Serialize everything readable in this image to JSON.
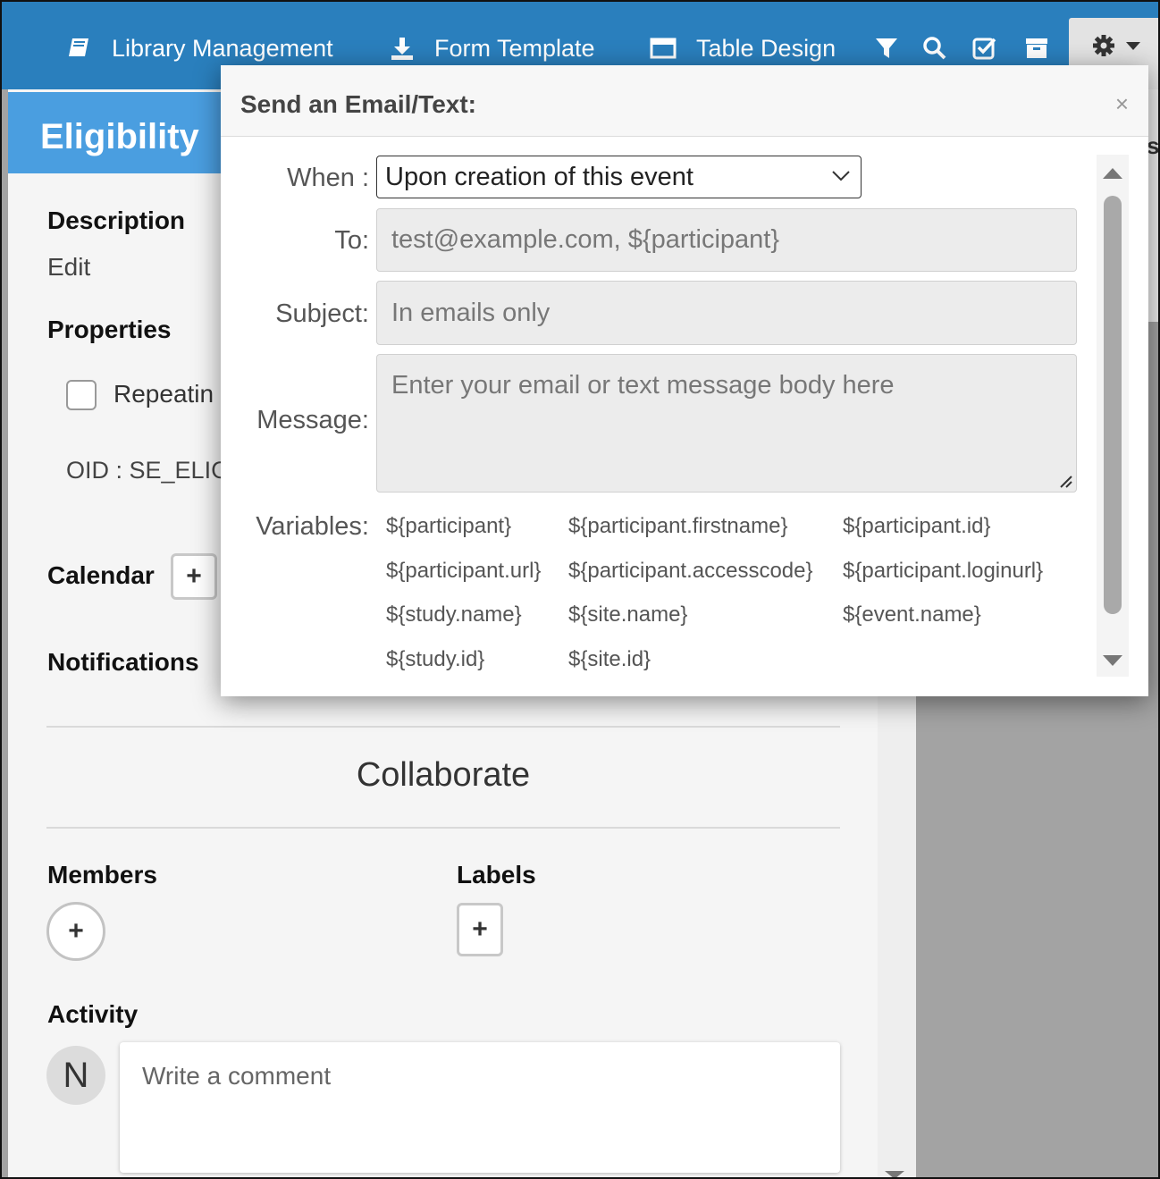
{
  "topbar": {
    "library_label": "Library Management",
    "form_template_label": "Form Template",
    "table_design_label": "Table Design",
    "icons": [
      "book-icon",
      "download-icon",
      "window-icon",
      "filter-icon",
      "search-icon",
      "check-square-icon",
      "archive-icon",
      "gear-icon",
      "caret-down-icon"
    ],
    "background_color": "#2a7fbd"
  },
  "panel": {
    "title": "Eligibility",
    "title_bg": "#4a9ee0",
    "description_heading": "Description",
    "description_value": "Edit",
    "properties_heading": "Properties",
    "repeating_label": "Repeatin",
    "oid_text": "OID : SE_ELIG",
    "calendar_heading": "Calendar",
    "notifications_heading": "Notifications",
    "collaborate_heading": "Collaborate",
    "members_heading": "Members",
    "labels_heading": "Labels",
    "activity_heading": "Activity",
    "avatar_initial": "N",
    "comment_placeholder": "Write a comment",
    "plus_symbol": "+"
  },
  "right_edge_char": "s",
  "modal": {
    "title": "Send an Email/Text:",
    "close_symbol": "×",
    "when_label": "When :",
    "when_value": "Upon creation of this event",
    "to_label": "To:",
    "to_placeholder": "test@example.com, ${participant}",
    "subject_label": "Subject:",
    "subject_placeholder": "In emails only",
    "message_label": "Message:",
    "message_placeholder": "Enter your email or text message body here",
    "variables_label": "Variables:",
    "variables": [
      "${participant}",
      "${participant.firstname}",
      "${participant.id}",
      "${participant.url}",
      "${participant.accesscode}",
      "${participant.loginurl}",
      "${study.name}",
      "${site.name}",
      "${event.name}",
      "${study.id}",
      "${site.id}"
    ]
  }
}
